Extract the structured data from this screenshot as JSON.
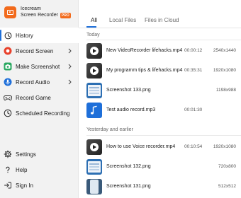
{
  "brand": {
    "name_line1": "Icecream",
    "name_line2": "Screen Recorder",
    "badge": "PRO"
  },
  "sidebar": {
    "items": [
      {
        "label": "History",
        "icon": "history-icon",
        "active": true,
        "submenu": false
      },
      {
        "label": "Record Screen",
        "icon": "record-icon",
        "submenu": true
      },
      {
        "label": "Make Screenshot",
        "icon": "camera-icon",
        "submenu": true
      },
      {
        "label": "Record Audio",
        "icon": "microphone-icon",
        "submenu": true
      },
      {
        "label": "Record Game",
        "icon": "gamepad-icon",
        "submenu": false
      },
      {
        "label": "Scheduled Recording",
        "icon": "clock-icon",
        "submenu": false
      }
    ],
    "bottom": [
      {
        "label": "Settings",
        "icon": "gear-icon"
      },
      {
        "label": "Help",
        "icon": "help-icon"
      },
      {
        "label": "Sign In",
        "icon": "sign-in-icon"
      }
    ]
  },
  "tabs": [
    {
      "label": "All",
      "active": true
    },
    {
      "label": "Local Files",
      "active": false
    },
    {
      "label": "Files in Cloud",
      "active": false
    }
  ],
  "sections": [
    {
      "title": "Today",
      "rows": [
        {
          "type": "video",
          "name": "New VideoRecorder lifehacks.mp4",
          "duration": "00:00:12",
          "resolution": "2540x1440"
        },
        {
          "type": "video",
          "name": "My programm tips & lifehacks.mp4",
          "duration": "00:35:31",
          "resolution": "1920x1080"
        },
        {
          "type": "image",
          "name": "Screenshot 133.png",
          "duration": "",
          "resolution": "1198x988"
        },
        {
          "type": "audio",
          "name": "Test audio record.mp3",
          "duration": "00:01:30",
          "resolution": ""
        }
      ]
    },
    {
      "title": "Yesterday and earlier",
      "rows": [
        {
          "type": "video",
          "name": "How to use Voice recorder.mp4",
          "duration": "00:10:54",
          "resolution": "1920x1080"
        },
        {
          "type": "image",
          "name": "Screenshot 132.png",
          "duration": "",
          "resolution": "720x800"
        },
        {
          "type": "phone",
          "name": "Screenshot 131.png",
          "duration": "",
          "resolution": "512x512"
        }
      ]
    }
  ],
  "colors": {
    "accent": "#1e6fd9",
    "brand": "#f26a1b",
    "record_red": "#e8402a",
    "camera_green": "#2aa860"
  }
}
